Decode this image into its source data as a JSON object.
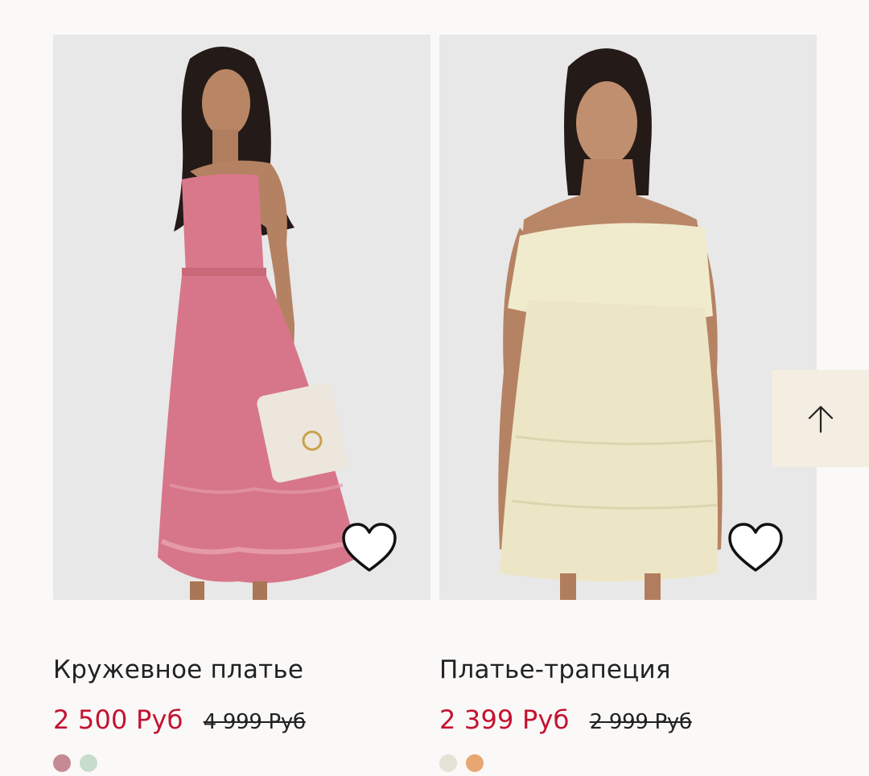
{
  "colors": {
    "background": "#faf9f8",
    "sale_price": "#c41230",
    "text": "#222222",
    "scroll_top_bg": "#f4ede2"
  },
  "products": [
    {
      "title": "Кружевное платье",
      "price_sale": "2 500 Руб",
      "price_old": "4 999 Руб",
      "favorite_icon": "heart-outline-icon",
      "swatches": [
        {
          "name": "dusty-pink",
          "color": "#c68a95"
        },
        {
          "name": "sage",
          "color": "#c7dccb"
        }
      ]
    },
    {
      "title": "Платье-трапеция",
      "price_sale": "2 399 Руб",
      "price_old": "2 999 Руб",
      "favorite_icon": "heart-outline-icon",
      "swatches": [
        {
          "name": "cream",
          "color": "#e3e2d6"
        },
        {
          "name": "apricot",
          "color": "#e8a770"
        }
      ]
    }
  ],
  "scroll_top": {
    "icon": "arrow-up-icon"
  }
}
